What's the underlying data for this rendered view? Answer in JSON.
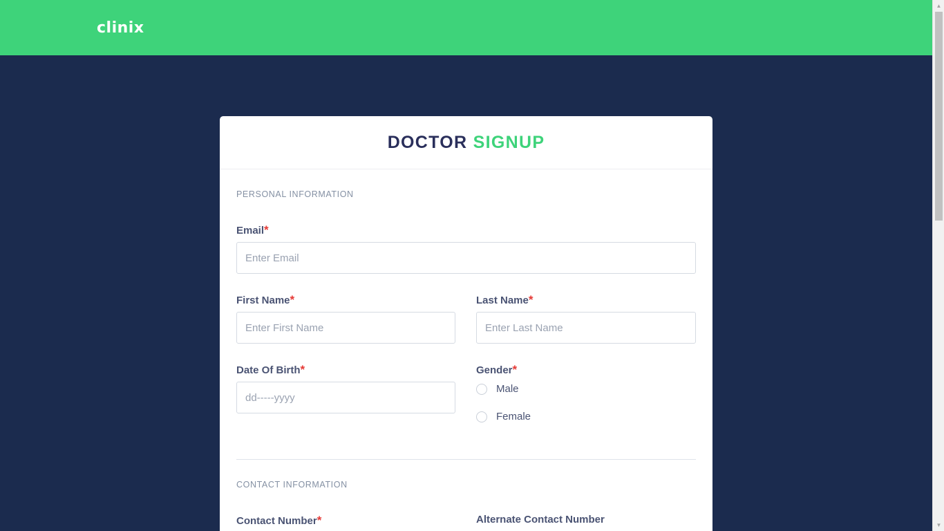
{
  "header": {
    "logo": "clinix"
  },
  "form": {
    "title_part1": "DOCTOR",
    "title_part2": "SIGNUP",
    "sections": {
      "personal": "PERSONAL INFORMATION",
      "contact": "CONTACT INFORMATION"
    },
    "required_mark": "*",
    "email": {
      "label": "Email",
      "placeholder": "Enter Email"
    },
    "first_name": {
      "label": "First Name",
      "placeholder": "Enter First Name"
    },
    "last_name": {
      "label": "Last Name",
      "placeholder": "Enter Last Name"
    },
    "dob": {
      "label": "Date Of Birth",
      "placeholder": "dd-----yyyy"
    },
    "gender": {
      "label": "Gender",
      "options": [
        "Male",
        "Female"
      ]
    },
    "contact_number": {
      "label": "Contact Number"
    },
    "alt_contact_number": {
      "label": "Alternate Contact Number"
    }
  },
  "colors": {
    "topbar": "#3ed37a",
    "background": "#1b2b4e",
    "accent": "#3ed37a",
    "title_dark": "#2a2f5b",
    "required": "#e53935"
  },
  "icons": {
    "scroll_up": "triangle-up",
    "scroll_down": "triangle-down"
  }
}
